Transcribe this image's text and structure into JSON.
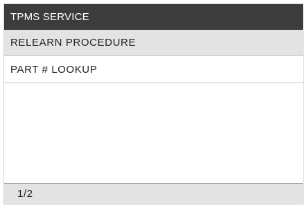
{
  "header": {
    "title": "TPMS SERVICE"
  },
  "menu": {
    "items": [
      {
        "label": "RELEARN PROCEDURE",
        "selected": true
      },
      {
        "label": "PART # LOOKUP",
        "selected": false
      }
    ]
  },
  "footer": {
    "page_indicator": "1/2"
  },
  "colors": {
    "title_bar_bg": "#3c3c3c",
    "selected_bg": "#e3e3e3",
    "status_bar_bg": "#e3e3e3"
  }
}
